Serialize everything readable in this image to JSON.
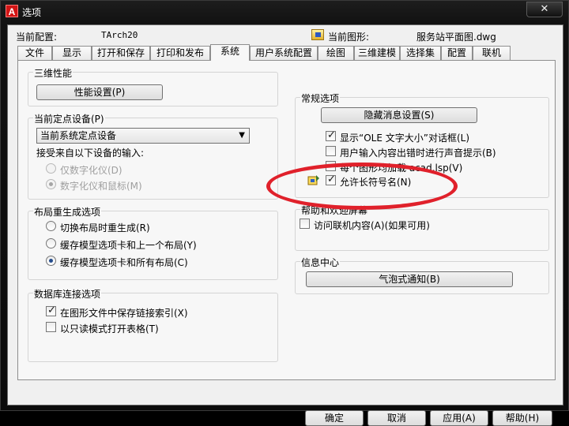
{
  "window": {
    "title": "选项",
    "app_icon_letter": "A",
    "close_symbol": "✕"
  },
  "profile": {
    "label": "当前配置:",
    "value": "TArch20",
    "drawing_label": "当前图形:",
    "drawing_value": "服务站平面图.dwg"
  },
  "tabs": [
    {
      "label": "文件"
    },
    {
      "label": "显示"
    },
    {
      "label": "打开和保存"
    },
    {
      "label": "打印和发布"
    },
    {
      "label": "系统",
      "active": true
    },
    {
      "label": "用户系统配置"
    },
    {
      "label": "绘图"
    },
    {
      "label": "三维建模"
    },
    {
      "label": "选择集"
    },
    {
      "label": "配置"
    },
    {
      "label": "联机"
    }
  ],
  "left": {
    "perf_group": {
      "title": "三维性能",
      "button": "性能设置(P)"
    },
    "pointing_group": {
      "title": "当前定点设备(P)",
      "select_value": "当前系统定点设备",
      "accept_label": "接受来自以下设备的输入:",
      "radio_digitizer": "仅数字化仪(D)",
      "radio_digitizer_mouse": "数字化仪和鼠标(M)"
    },
    "regen_group": {
      "title": "布局重生成选项",
      "radio_1": "切换布局时重生成(R)",
      "radio_2": "缓存模型选项卡和上一个布局(Y)",
      "radio_3": "缓存模型选项卡和所有布局(C)"
    },
    "db_group": {
      "title": "数据库连接选项",
      "check_1": "在图形文件中保存链接索引(X)",
      "check_2": "以只读模式打开表格(T)"
    }
  },
  "right": {
    "general_group": {
      "title": "常规选项",
      "button": "隐藏消息设置(S)",
      "check_1": "显示“OLE 文字大小”对话框(L)",
      "check_2": "用户输入内容出错时进行声音提示(B)",
      "check_3": "每个图形均加载 acad.lsp(V)",
      "check_4": "允许长符号名(N)"
    },
    "help_group": {
      "title": "帮助和欢迎屏幕",
      "check_1": "访问联机内容(A)(如果可用)"
    },
    "info_group": {
      "title": "信息中心",
      "button": "气泡式通知(B)"
    }
  },
  "buttons": {
    "ok": "确定",
    "cancel": "取消",
    "apply": "应用(A)",
    "help": "帮助(H)"
  },
  "colors": {
    "annotation_circle": "#e0212b",
    "title_bar": "#111111",
    "dialog_background": "#f0f0f0"
  },
  "icons": {
    "app": "autocad-icon",
    "drawing": "dwg-file-icon",
    "warning": "drawing-saved-icon"
  }
}
